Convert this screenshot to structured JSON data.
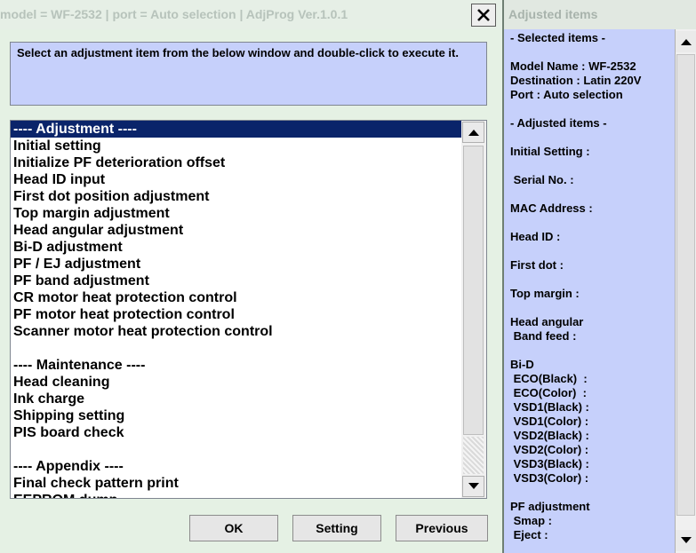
{
  "window": {
    "title": "model = WF-2532 | port = Auto selection | AdjProg Ver.1.0.1"
  },
  "instruction": "Select an adjustment item from the below window and double-click to execute it.",
  "list": {
    "items": [
      "---- Adjustment ----",
      "Initial setting",
      "Initialize PF deterioration offset",
      "Head ID input",
      "First dot position adjustment",
      "Top margin adjustment",
      "Head angular adjustment",
      "Bi-D adjustment",
      "PF / EJ adjustment",
      "PF band adjustment",
      "CR motor heat protection control",
      "PF motor heat protection control",
      "Scanner motor heat protection control",
      "",
      "---- Maintenance ----",
      "Head cleaning",
      "Ink charge",
      "Shipping setting",
      "PIS board check",
      "",
      "---- Appendix ----",
      "Final check pattern print",
      "EEPROM dump"
    ],
    "selected_index": 0
  },
  "buttons": {
    "ok": "OK",
    "setting": "Setting",
    "previous": "Previous"
  },
  "side_panel": {
    "title": "Adjusted items",
    "lines": [
      "- Selected items -",
      "",
      "Model Name : WF-2532",
      "Destination : Latin 220V",
      "Port : Auto selection",
      "",
      "- Adjusted items -",
      "",
      "Initial Setting :",
      "",
      " Serial No. :",
      "",
      "MAC Address :",
      "",
      "Head ID :",
      "",
      "First dot :",
      "",
      "Top margin :",
      "",
      "Head angular",
      " Band feed :",
      "",
      "Bi-D",
      " ECO(Black)  :",
      " ECO(Color)  :",
      " VSD1(Black) :",
      " VSD1(Color) :",
      " VSD2(Black) :",
      " VSD2(Color) :",
      " VSD3(Black) :",
      " VSD3(Color) :",
      "",
      "PF adjustment",
      " Smap :",
      " Eject :"
    ]
  },
  "icons": {
    "close": "close-icon",
    "scroll_up": "chevron-up-icon",
    "scroll_down": "chevron-down-icon"
  },
  "colors": {
    "selection": "#0a246a",
    "panel_blue": "#c6d0fb",
    "window_bg": "#e5f1e4"
  }
}
